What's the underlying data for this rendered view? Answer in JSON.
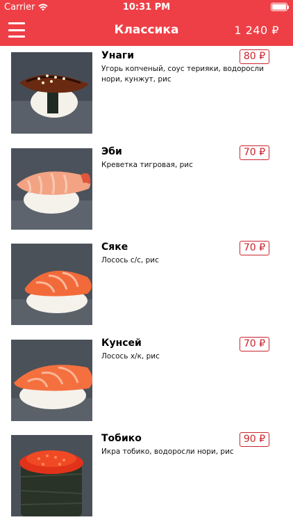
{
  "status": {
    "carrier": "Carrier",
    "time": "10:31 PM"
  },
  "nav": {
    "title": "Классика",
    "total": "1 240 ₽"
  },
  "colors": {
    "accent": "#ee3f46",
    "price": "#c9242c"
  },
  "items": [
    {
      "name": "Унаги",
      "desc": "Угорь копченый, соус терияки, водоросли нори, кунжут, рис",
      "price": "80 ₽"
    },
    {
      "name": "Эби",
      "desc": "Креветка тигровая, рис",
      "price": "70 ₽"
    },
    {
      "name": "Сяке",
      "desc": "Лосось с/с, рис",
      "price": "70 ₽"
    },
    {
      "name": "Кунсей",
      "desc": "Лосось х/к, рис",
      "price": "70 ₽"
    },
    {
      "name": "Тобико",
      "desc": "Икра тобико, водоросли нори, рис",
      "price": "90 ₽"
    }
  ]
}
